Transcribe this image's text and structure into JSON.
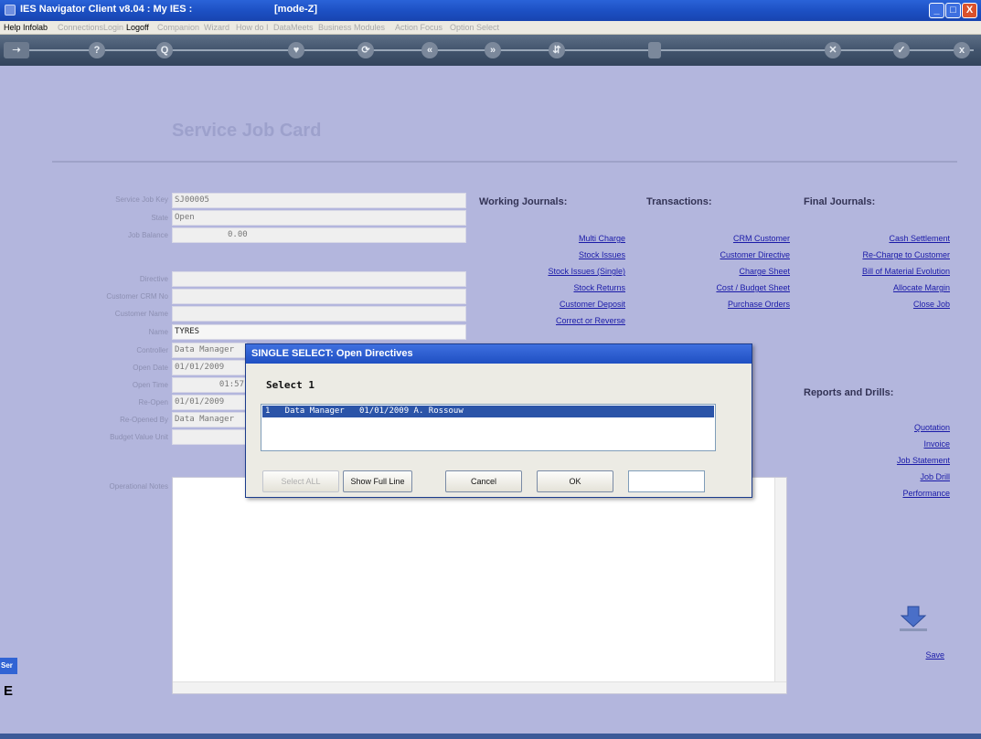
{
  "window": {
    "title": "IES Navigator Client v8.04 : My IES :",
    "mode": "[mode-Z]",
    "min_label": "_",
    "max_label": "□",
    "close_label": "X"
  },
  "menu": [
    {
      "label": "Help",
      "enabled": true
    },
    {
      "label": "Infolab",
      "enabled": true
    },
    {
      "label": "Connections",
      "enabled": false
    },
    {
      "label": "Login",
      "enabled": false
    },
    {
      "label": "Logoff",
      "enabled": true
    },
    {
      "label": "Companion",
      "enabled": false
    },
    {
      "label": "Wizard",
      "enabled": false
    },
    {
      "label": "How do I",
      "enabled": false
    },
    {
      "label": "DataMeets",
      "enabled": false
    },
    {
      "label": "Business Modules",
      "enabled": false
    },
    {
      "label": "Action Focus",
      "enabled": false
    },
    {
      "label": "Option Select",
      "enabled": false
    }
  ],
  "toolbar": {
    "help": "?",
    "search": "Q",
    "heart": "♥",
    "refresh": "⟳",
    "prev": "«",
    "next": "»",
    "cancel": "✕",
    "accept": "✓",
    "close": "x"
  },
  "form": {
    "heading": "Service Job Card",
    "fields": [
      {
        "label": "Service Job Key",
        "value": "SJ00005"
      },
      {
        "label": "State",
        "value": "Open"
      },
      {
        "label": "Job Balance",
        "value": "0.00"
      },
      {
        "label": "Directive",
        "value": ""
      },
      {
        "label": "Customer CRM No",
        "value": ""
      },
      {
        "label": "Customer Name",
        "value": ""
      },
      {
        "label": "Name",
        "value": "TYRES"
      },
      {
        "label": "Controller",
        "value": "Data Manager"
      },
      {
        "label": "Open Date",
        "value": "01/01/2009"
      },
      {
        "label": "Open Time",
        "value": "01:57"
      },
      {
        "label": "Re-Open",
        "value": "01/01/2009"
      },
      {
        "label": "Re-Opened By",
        "value": "Data Manager"
      },
      {
        "label": "Budget Value Unit",
        "value": ""
      }
    ],
    "notes_label": "Operational Notes"
  },
  "columns": {
    "working": {
      "title": "Working Journals:",
      "links": [
        "Multi Charge",
        "Stock Issues",
        "Stock Issues (Single)",
        "Stock Returns",
        "Customer Deposit",
        "Correct or Reverse"
      ]
    },
    "transactions": {
      "title": "Transactions:",
      "links": [
        "CRM Customer",
        "Customer Directive",
        "Charge Sheet",
        "Cost / Budget Sheet",
        "Purchase Orders"
      ]
    },
    "final": {
      "title": "Final Journals:",
      "links": [
        "Cash Settlement",
        "Re-Charge to Customer",
        "Bill of Material Evolution",
        "Allocate Margin",
        "Close Job"
      ]
    },
    "reports": {
      "title": "Reports and Drills:",
      "links": [
        "Quotation",
        "Invoice",
        "Job Statement",
        "Job Drill",
        "Performance"
      ]
    }
  },
  "save_label": "Save",
  "side_tab": "Ser",
  "side_glyph": "E",
  "dialog": {
    "title": "SINGLE SELECT: Open Directives",
    "prompt": "Select 1",
    "rows": [
      "1   Data Manager   01/01/2009 A. Rossouw"
    ],
    "buttons": {
      "select_all": "Select ALL",
      "show_full_line": "Show Full Line",
      "cancel": "Cancel",
      "ok": "OK"
    },
    "input_value": ""
  },
  "colors": {
    "background": "#b3b6dd",
    "link": "#1a1aa8",
    "title_bar": "#1f4fc2",
    "selected_row": "#2b54a8"
  }
}
